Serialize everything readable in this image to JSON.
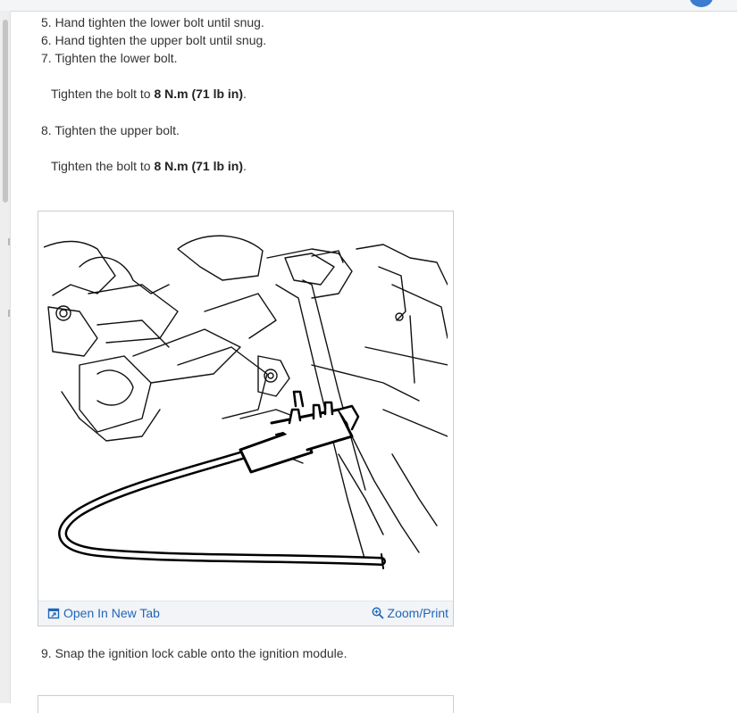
{
  "steps": {
    "s5": "5. Hand tighten the lower bolt until snug.",
    "s6": "6. Hand tighten the upper bolt until snug.",
    "s7": "7. Tighten the lower bolt.",
    "s8": "8. Tighten the upper bolt.",
    "s9": "9. Snap the ignition lock cable onto the ignition module."
  },
  "notes": {
    "prefix": "Tighten the bolt to ",
    "spec": "8 N.m (71 lb in)",
    "suffix": "."
  },
  "figure": {
    "open_label": "Open In New Tab",
    "zoom_label": "Zoom/Print",
    "open_icon": "open-in-new-tab-icon",
    "zoom_icon": "zoom-in-icon"
  },
  "colors": {
    "link": "#2166b8",
    "text": "#333333",
    "footer_bg": "#f2f4f7"
  }
}
